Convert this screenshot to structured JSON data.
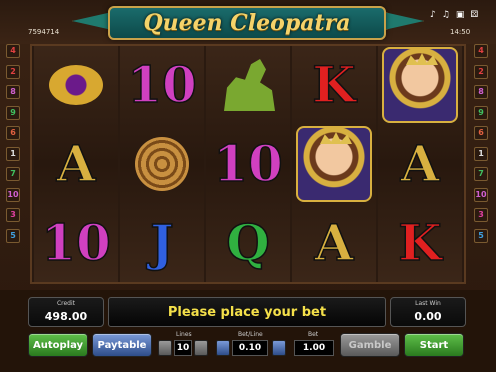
{
  "title": "Queen Cleopatra",
  "credits_id": "7594714",
  "clock": "14:50",
  "top_icons": [
    "music-note-icon",
    "music-note-icon",
    "money-icon",
    "dice-icon"
  ],
  "lines_left": [
    "4",
    "2",
    "8",
    "9",
    "6",
    "1",
    "7",
    "10",
    "3",
    "5"
  ],
  "lines_right": [
    "4",
    "2",
    "8",
    "9",
    "6",
    "1",
    "7",
    "10",
    "3",
    "5"
  ],
  "reels": [
    [
      {
        "type": "ring"
      },
      {
        "type": "letter",
        "text": "A",
        "color": "#d8b040"
      },
      {
        "type": "letter",
        "text": "10",
        "color": "#d040c0"
      }
    ],
    [
      {
        "type": "letter",
        "text": "10",
        "color": "#d040c0"
      },
      {
        "type": "snake"
      },
      {
        "type": "letter",
        "text": "J",
        "color": "#3060e0"
      }
    ],
    [
      {
        "type": "sphinx"
      },
      {
        "type": "letter",
        "text": "10",
        "color": "#d040c0"
      },
      {
        "type": "letter",
        "text": "Q",
        "color": "#30b040"
      }
    ],
    [
      {
        "type": "letter",
        "text": "K",
        "color": "#e02020"
      },
      {
        "type": "portrait"
      },
      {
        "type": "letter",
        "text": "A",
        "color": "#d8b040"
      }
    ],
    [
      {
        "type": "portrait"
      },
      {
        "type": "letter",
        "text": "A",
        "color": "#d8b040"
      },
      {
        "type": "letter",
        "text": "K",
        "color": "#e02020"
      }
    ]
  ],
  "credit": {
    "label": "Credit",
    "value": "498.00"
  },
  "message": "Please place your bet",
  "last_win": {
    "label": "Last Win",
    "value": "0.00"
  },
  "buttons": {
    "autoplay": "Autoplay",
    "paytable": "Paytable",
    "gamble": "Gamble",
    "start": "Start"
  },
  "lines": {
    "label": "Lines",
    "value": "10"
  },
  "bet_line": {
    "label": "Bet/Line",
    "value": "0.10"
  },
  "bet": {
    "label": "Bet",
    "value": "1.00"
  },
  "colors": {
    "gold": "#f4d36a",
    "message": "#f4e04a",
    "green_button": "#2a7a1e",
    "blue_button": "#2e4d8a"
  }
}
